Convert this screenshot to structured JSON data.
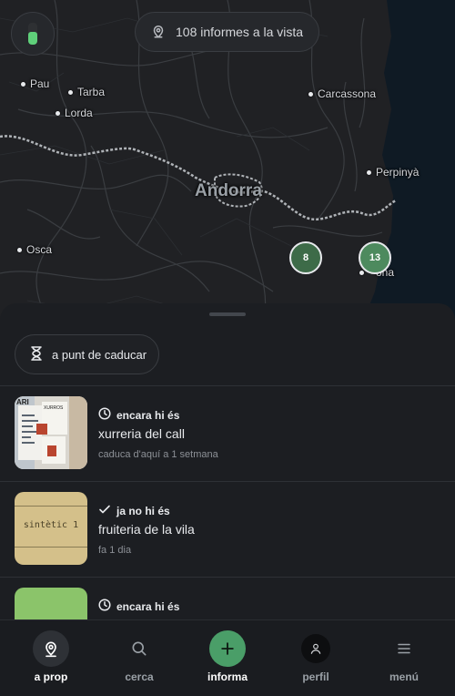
{
  "map": {
    "reports_label": "108 informes a la vista",
    "battery_level": 0.6,
    "country_label": "Andorra",
    "cities": [
      {
        "name": "Pau"
      },
      {
        "name": "Tarba"
      },
      {
        "name": "Lorda"
      },
      {
        "name": "Carcassona"
      },
      {
        "name": "Perpinyà"
      },
      {
        "name": "Osca"
      }
    ],
    "clusters": [
      {
        "count": "8",
        "color": "#3d6b48"
      },
      {
        "count": "13",
        "color": "#4d8a5e"
      }
    ],
    "partial_label": "ona"
  },
  "filter": {
    "label": "a punt de caducar",
    "icon": "hourglass-icon"
  },
  "reports": [
    {
      "status": "encara hi és",
      "status_icon": "clock-icon",
      "title": "xurreria del call",
      "meta": "caduca d'aquí a 1 setmana",
      "thumb_sign": "ARI",
      "thumb_sign2": "XURROS"
    },
    {
      "status": "ja no hi és",
      "status_icon": "check-icon",
      "title": "fruiteria de la vila",
      "meta": "fa 1 dia",
      "thumb_text": "sintètic 1",
      "thumb_color": "#d4c08a"
    },
    {
      "status": "encara hi és",
      "status_icon": "clock-icon",
      "thumb_color": "#8bc46a"
    }
  ],
  "nav": {
    "items": [
      {
        "label": "a prop",
        "icon": "map-pin-icon",
        "active": true
      },
      {
        "label": "cerca",
        "icon": "search-icon"
      },
      {
        "label": "informa",
        "icon": "plus-icon",
        "active": true
      },
      {
        "label": "perfil",
        "icon": "user-icon"
      },
      {
        "label": "menú",
        "icon": "menu-icon"
      }
    ]
  },
  "colors": {
    "accent": "#4a9e68",
    "battery": "#5fd07a"
  }
}
